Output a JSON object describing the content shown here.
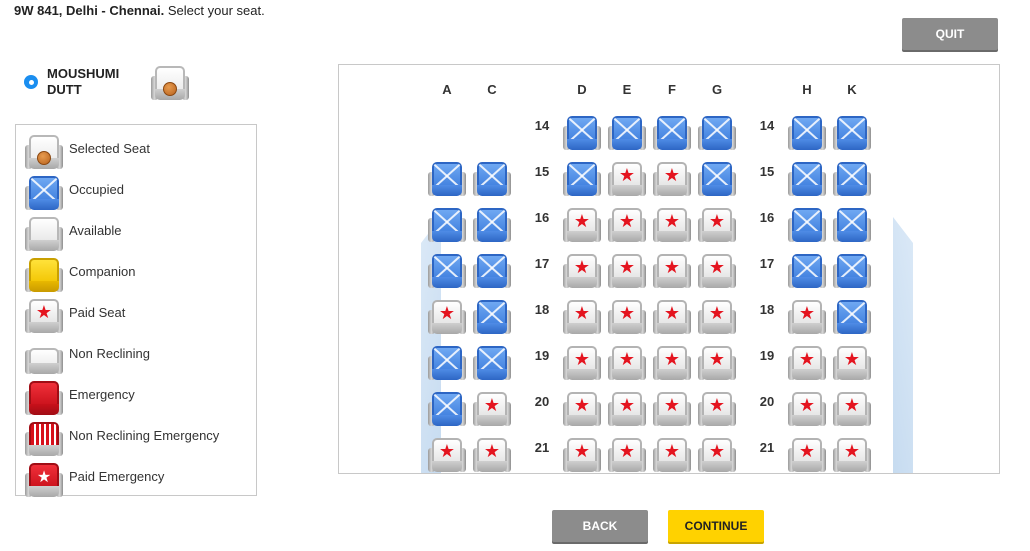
{
  "header": {
    "flight": "9W 841, Delhi - Chennai.",
    "instruction": " Select your seat."
  },
  "buttons": {
    "quit": "QUIT",
    "back": "BACK",
    "continue": "CONTINUE"
  },
  "passenger": {
    "name": "MOUSHUMI DUTT",
    "selected": true
  },
  "legend": [
    {
      "label": "Selected Seat",
      "type": "selected"
    },
    {
      "label": "Occupied",
      "type": "occupied"
    },
    {
      "label": "Available",
      "type": "available"
    },
    {
      "label": "Companion",
      "type": "companion"
    },
    {
      "label": "Paid Seat",
      "type": "paid"
    },
    {
      "label": "Non Reclining",
      "type": "nonrecline"
    },
    {
      "label": "Emergency",
      "type": "emergency"
    },
    {
      "label": "Non Reclining Emergency",
      "type": "nr-emergency"
    },
    {
      "label": "Paid Emergency",
      "type": "paid-emergency"
    }
  ],
  "seatmap": {
    "columns": [
      "A",
      "C",
      "D",
      "E",
      "F",
      "G",
      "H",
      "K"
    ],
    "rows": [
      {
        "number": "14",
        "seats": {
          "A": null,
          "C": null,
          "D": "occupied",
          "E": "occupied",
          "F": "occupied",
          "G": "occupied",
          "H": "occupied",
          "K": "occupied"
        }
      },
      {
        "number": "15",
        "seats": {
          "A": "occupied",
          "C": "occupied",
          "D": "occupied",
          "E": "paid",
          "F": "paid",
          "G": "occupied",
          "H": "occupied",
          "K": "occupied"
        }
      },
      {
        "number": "16",
        "seats": {
          "A": "occupied",
          "C": "occupied",
          "D": "paid",
          "E": "paid",
          "F": "paid",
          "G": "paid",
          "H": "occupied",
          "K": "occupied"
        }
      },
      {
        "number": "17",
        "seats": {
          "A": "occupied",
          "C": "occupied",
          "D": "paid",
          "E": "paid",
          "F": "paid",
          "G": "paid",
          "H": "occupied",
          "K": "occupied"
        }
      },
      {
        "number": "18",
        "seats": {
          "A": "paid",
          "C": "occupied",
          "D": "paid",
          "E": "paid",
          "F": "paid",
          "G": "paid",
          "H": "paid",
          "K": "occupied"
        }
      },
      {
        "number": "19",
        "seats": {
          "A": "occupied",
          "C": "occupied",
          "D": "paid",
          "E": "paid",
          "F": "paid",
          "G": "paid",
          "H": "paid",
          "K": "paid"
        }
      },
      {
        "number": "20",
        "seats": {
          "A": "occupied",
          "C": "paid",
          "D": "paid",
          "E": "paid",
          "F": "paid",
          "G": "paid",
          "H": "paid",
          "K": "paid"
        }
      },
      {
        "number": "21",
        "seats": {
          "A": "paid",
          "C": "paid",
          "D": "paid",
          "E": "paid",
          "F": "paid",
          "G": "paid",
          "H": "paid",
          "K": "paid"
        }
      }
    ]
  }
}
